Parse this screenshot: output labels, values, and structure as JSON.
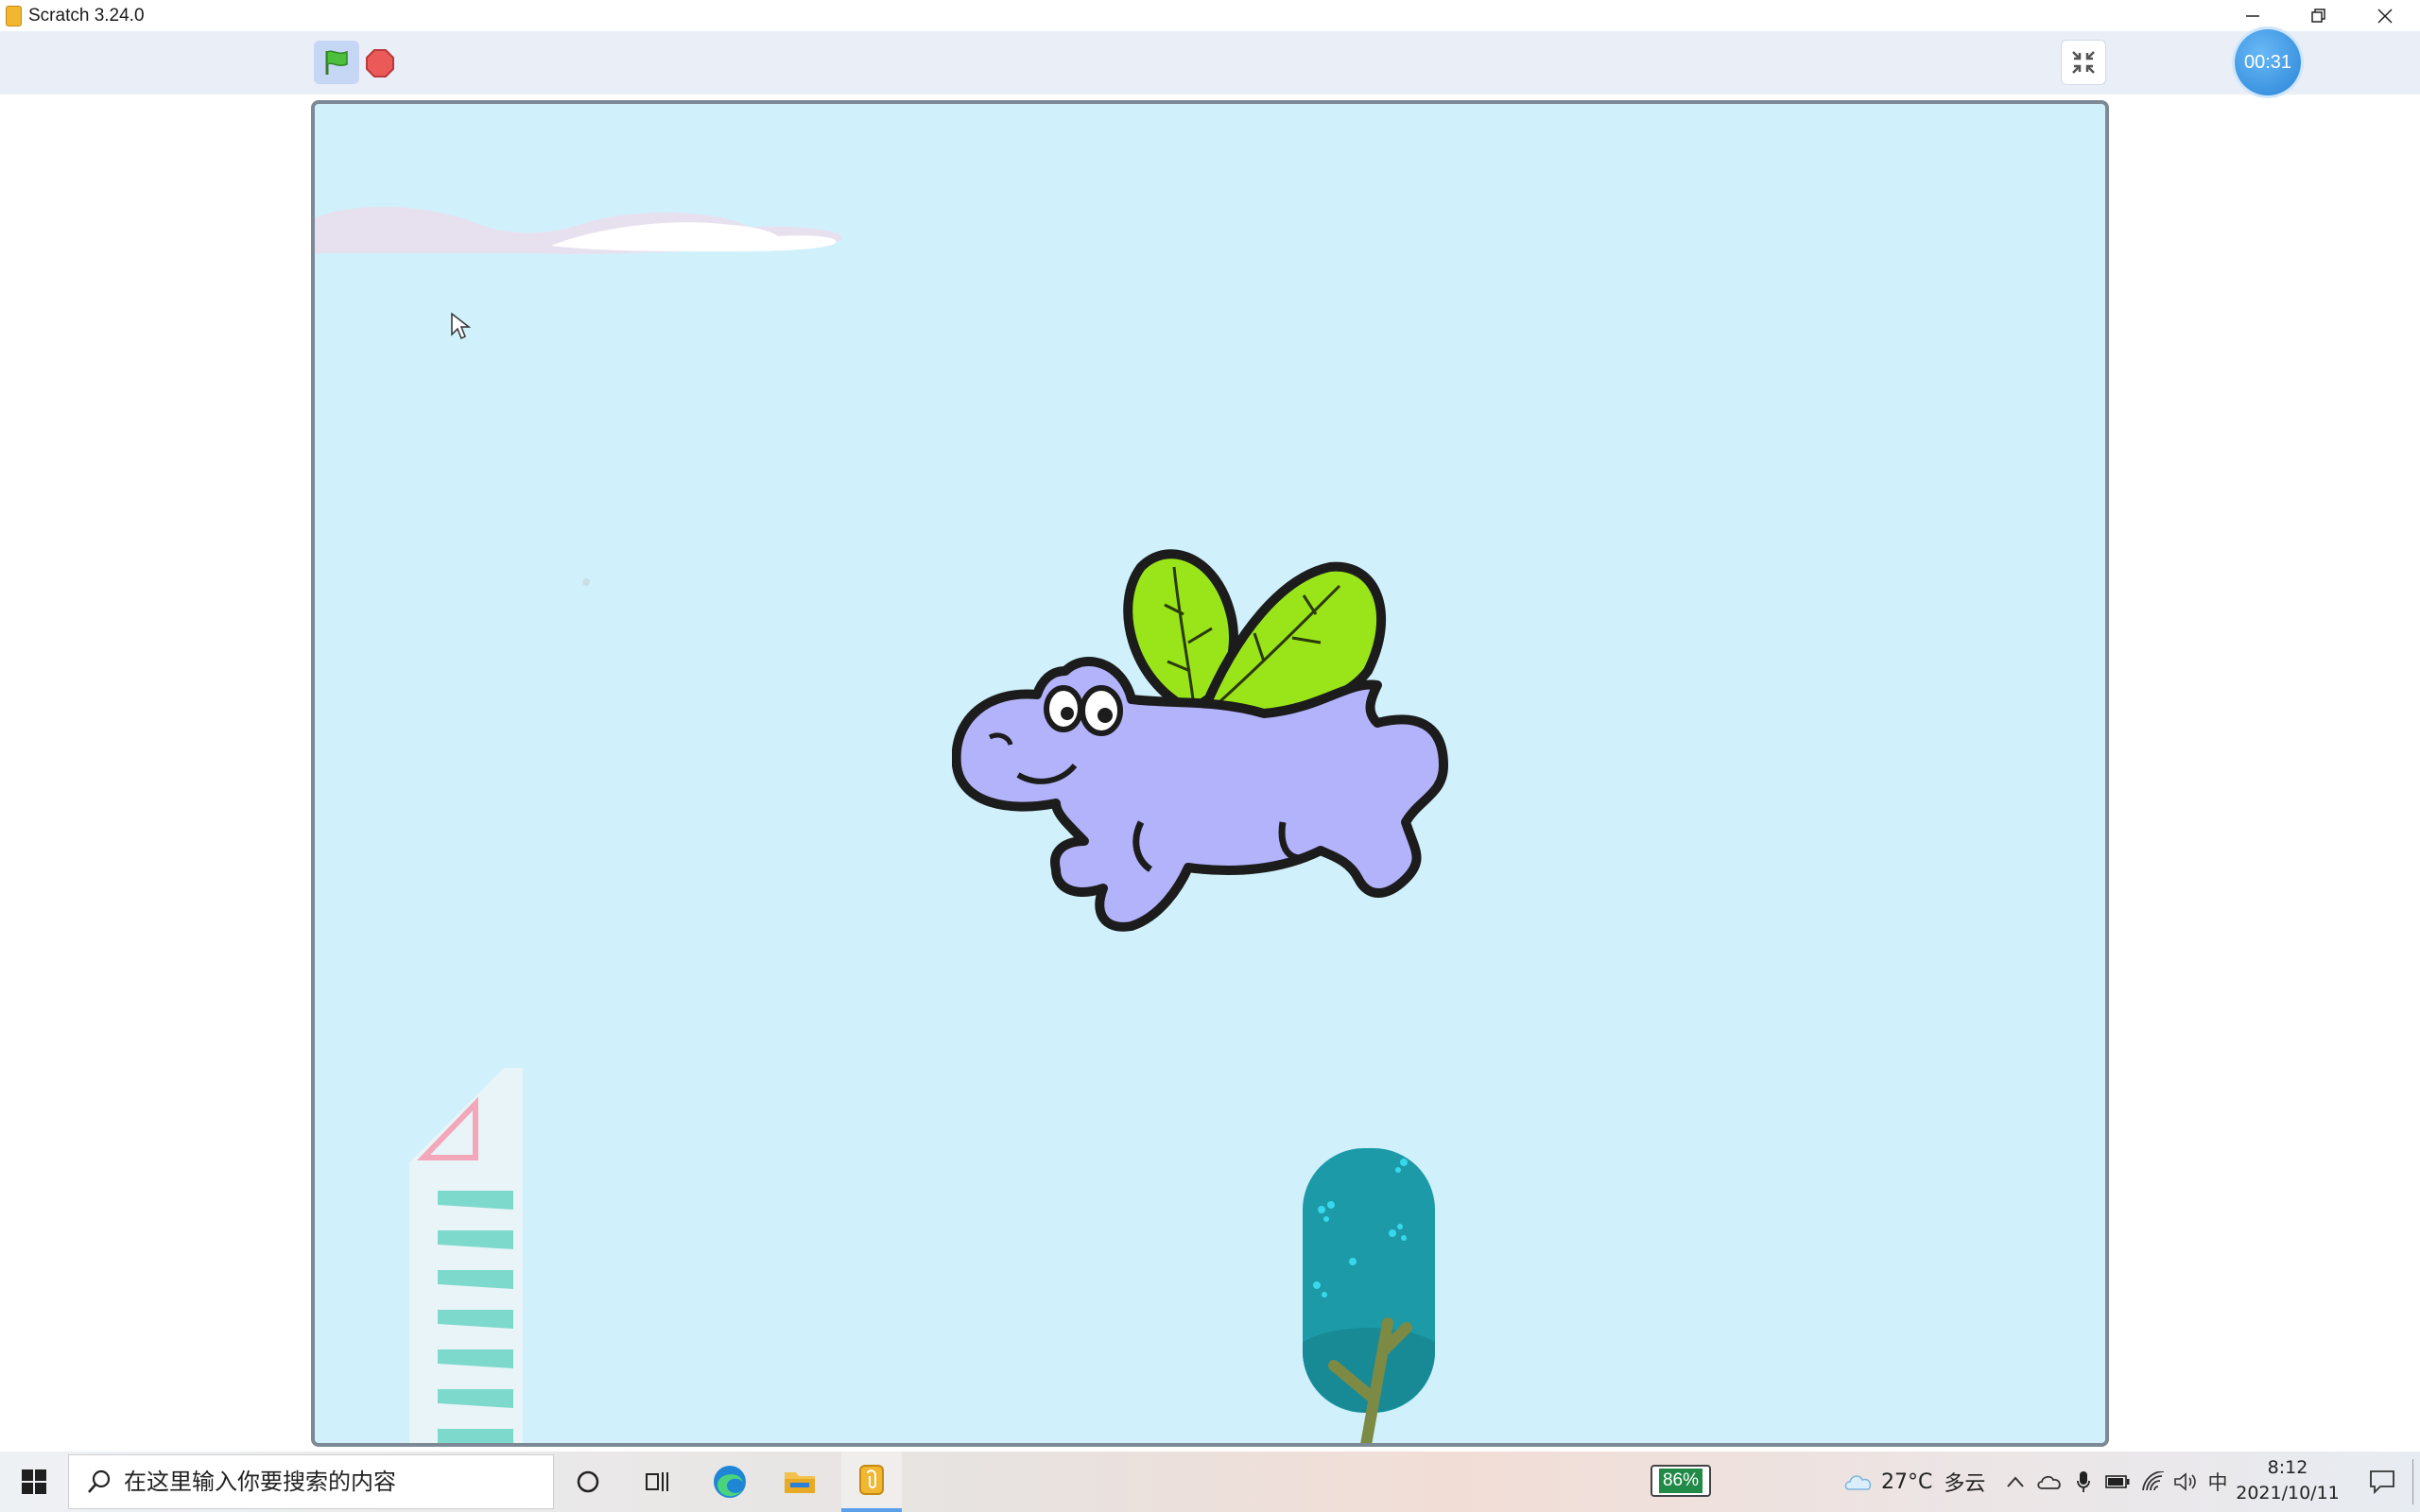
{
  "window": {
    "title": "Scratch 3.24.0",
    "controls": {
      "minimize": "—",
      "restore": "❐",
      "close": "✕"
    }
  },
  "toolbar": {
    "green_flag": "green-flag-icon",
    "stop": "stop-icon",
    "unfullscreen": "unfullscreen-icon",
    "timer": "00:31"
  },
  "stage": {
    "background_color": "#d0f1fc",
    "sprites": [
      "cloud",
      "hippo-flying",
      "building",
      "tree",
      "mouse-cursor"
    ]
  },
  "taskbar": {
    "search_placeholder": "在这里输入你要搜索的内容",
    "battery_percent": "86%",
    "weather_temp": "27°C",
    "weather_desc": "多云",
    "ime": "中",
    "time": "8:12",
    "date": "2021/10/11",
    "apps": [
      "cortana-icon",
      "task-view-icon",
      "edge-icon",
      "file-explorer-icon",
      "scratch-icon"
    ]
  },
  "colors": {
    "accent": "#2b85d8",
    "hippo_body": "#b3b3fb",
    "wing": "#9ae51a",
    "tree": "#1d9aa8",
    "stripe": "#7ed9cd"
  }
}
